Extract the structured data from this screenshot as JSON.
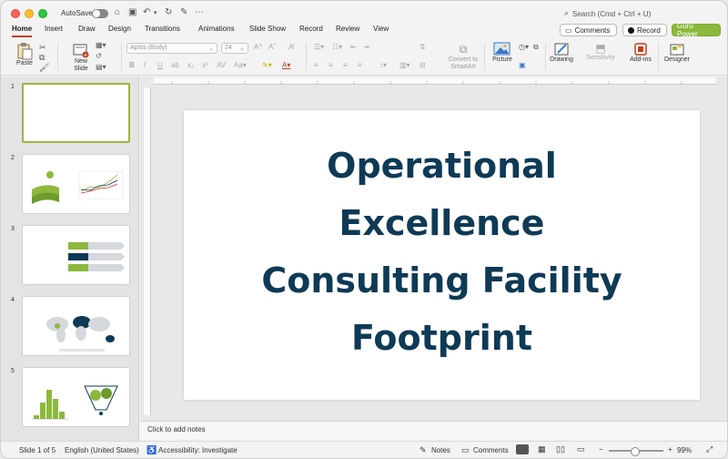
{
  "titlebar": {
    "autosave_label": "AutoSave",
    "search_placeholder": "Search (Cmd + Ctrl + U)"
  },
  "tabs": [
    "Home",
    "Insert",
    "Draw",
    "Design",
    "Transitions",
    "Animations",
    "Slide Show",
    "Record",
    "Review",
    "View"
  ],
  "active_tab": "Home",
  "header_buttons": {
    "comments": "Comments",
    "record": "Record",
    "guru": "Guru Power"
  },
  "ribbon": {
    "paste": "Paste",
    "new_slide": "New Slide",
    "font_name": "Aptos (Body)",
    "font_size": "24",
    "convert_smartart": "Convert to SmartArt",
    "picture": "Picture",
    "drawing": "Drawing",
    "sensitivity": "Sensitivity",
    "addins": "Add-ins",
    "designer": "Designer"
  },
  "thumbnails": [
    {
      "num": "1"
    },
    {
      "num": "2"
    },
    {
      "num": "3"
    },
    {
      "num": "4"
    },
    {
      "num": "5"
    }
  ],
  "slide": {
    "title_lines": [
      "Operational",
      "Excellence",
      "Consulting Facility",
      "Footprint"
    ]
  },
  "notes_placeholder": "Click to add notes",
  "status": {
    "slide_of": "Slide 1 of 5",
    "language": "English (United States)",
    "accessibility": "Accessibility: Investigate",
    "notes": "Notes",
    "comments": "Comments",
    "zoom": "99%"
  },
  "colors": {
    "title_text": "#0e3a56",
    "accent_green": "#8cb93c",
    "active_tab_underline": "#c43e1c"
  }
}
